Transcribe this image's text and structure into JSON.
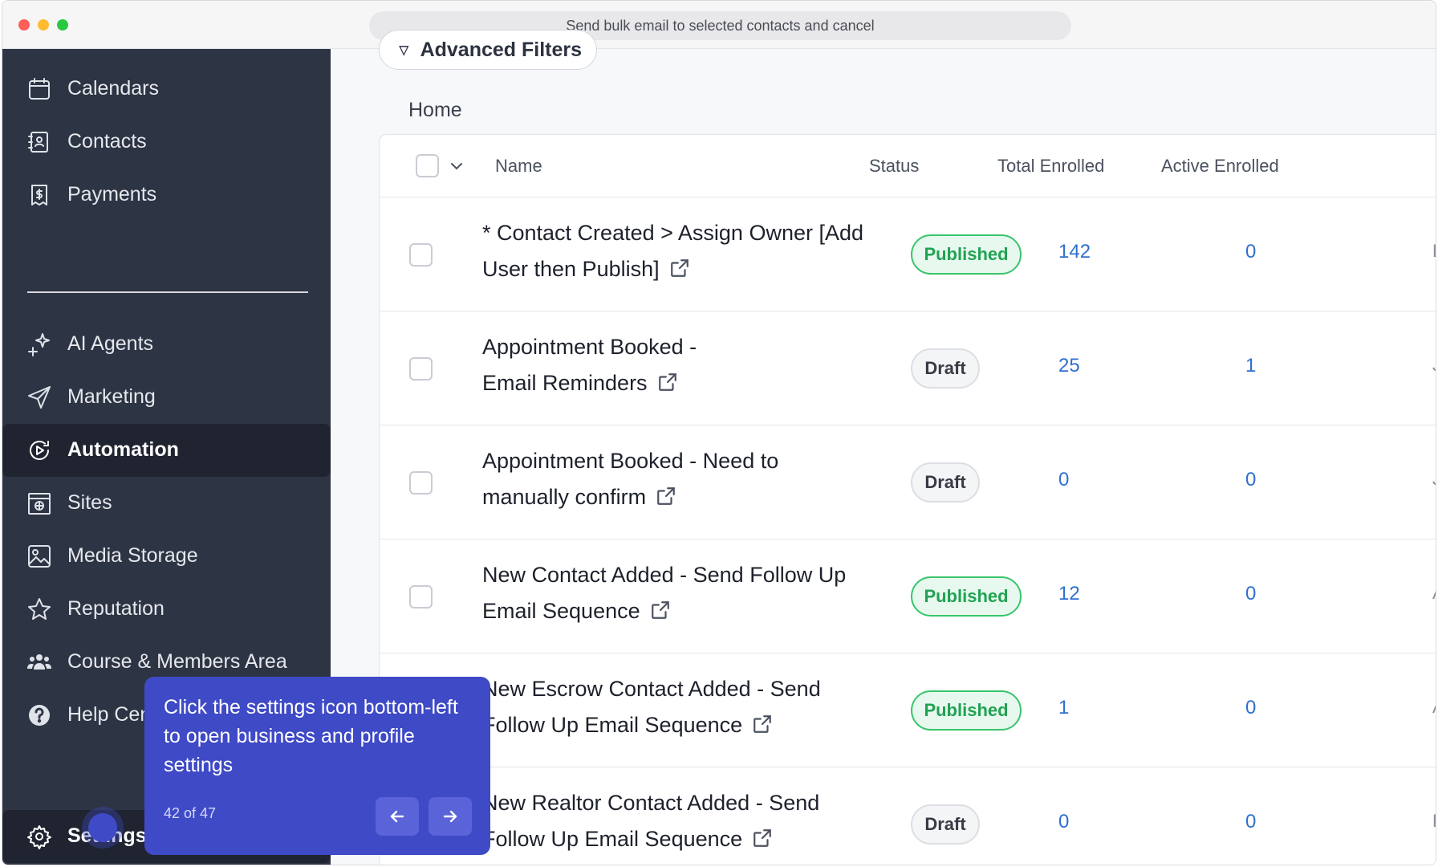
{
  "window": {
    "url_text": "Send bulk email to selected contacts and cancel"
  },
  "sidebar": {
    "items": [
      {
        "label": "Calendars",
        "icon": "calendar-icon"
      },
      {
        "label": "Contacts",
        "icon": "contacts-icon"
      },
      {
        "label": "Payments",
        "icon": "payments-icon"
      },
      {
        "label": "AI Agents",
        "icon": "sparkle-icon"
      },
      {
        "label": "Marketing",
        "icon": "send-icon"
      },
      {
        "label": "Automation",
        "icon": "automation-icon",
        "active": true
      },
      {
        "label": "Sites",
        "icon": "sites-icon"
      },
      {
        "label": "Media Storage",
        "icon": "image-icon"
      },
      {
        "label": "Reputation",
        "icon": "star-icon"
      },
      {
        "label": "Course & Members Area",
        "icon": "people-icon"
      },
      {
        "label": "Help Center",
        "icon": "help-icon"
      }
    ],
    "settings_label": "Settings"
  },
  "content": {
    "advanced_filters_label": "Advanced Filters",
    "breadcrumb": "Home",
    "table": {
      "headers": {
        "name": "Name",
        "status": "Status",
        "total": "Total Enrolled",
        "active": "Active Enrolled"
      },
      "rows": [
        {
          "name": "* Contact Created > Assign Owner [Add User then Publish]",
          "status": "Published",
          "total": "142",
          "active": "0",
          "edge": "D"
        },
        {
          "name": "Appointment Booked - Email Reminders",
          "status": "Draft",
          "total": "25",
          "active": "1",
          "edge": "J"
        },
        {
          "name": "Appointment Booked - Need to manually confirm",
          "status": "Draft",
          "total": "0",
          "active": "0",
          "edge": "J"
        },
        {
          "name": "New Contact Added - Send Follow Up Email Sequence",
          "status": "Published",
          "total": "12",
          "active": "0",
          "edge": "A"
        },
        {
          "name": "New Escrow Contact Added - Send Follow Up Email Sequence",
          "status": "Published",
          "total": "1",
          "active": "0",
          "edge": "A"
        },
        {
          "name": "New Realtor Contact Added - Send Follow Up Email Sequence",
          "status": "Draft",
          "total": "0",
          "active": "0",
          "edge": "F"
        }
      ]
    }
  },
  "tooltip": {
    "text": "Click the settings icon bottom-left to open business and profile settings",
    "step": "42 of 47"
  },
  "colors": {
    "sidebar_bg": "#2d3444",
    "accent": "#3f4ac6",
    "published": "#21a253",
    "link": "#2f6fd0"
  }
}
